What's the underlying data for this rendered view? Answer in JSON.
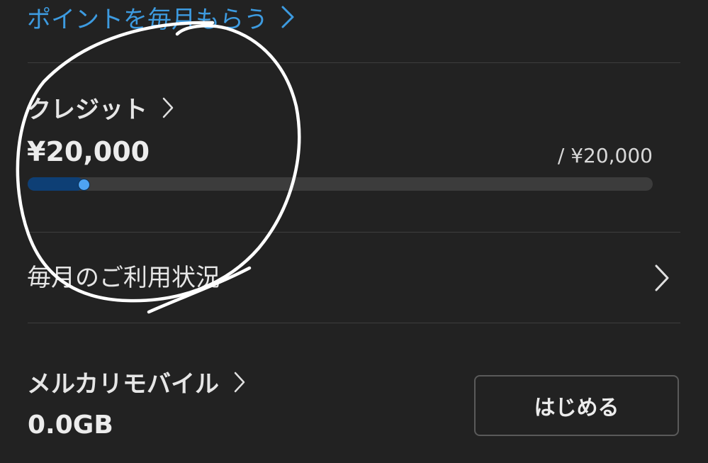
{
  "points": {
    "link_label": "ポイントを毎月もらう",
    "chevron_icon": "chevron-right-icon",
    "color": "#3d9be0"
  },
  "credit": {
    "title": "クレジット",
    "amount": "¥20,000",
    "limit": "/ ¥20,000",
    "progress_fraction": 0.09,
    "bar_fill_color": "#0e3f75",
    "knob_color": "#4ea3f2"
  },
  "usage": {
    "label": "毎月のご利用状況",
    "chevron_icon": "chevron-right-icon"
  },
  "mobile": {
    "title": "メルカリモバイル",
    "data_amount": "0.0GB",
    "start_button": "はじめる"
  },
  "annotation": {
    "type": "hand-drawn white circle around the credit section",
    "color": "#ffffff"
  }
}
